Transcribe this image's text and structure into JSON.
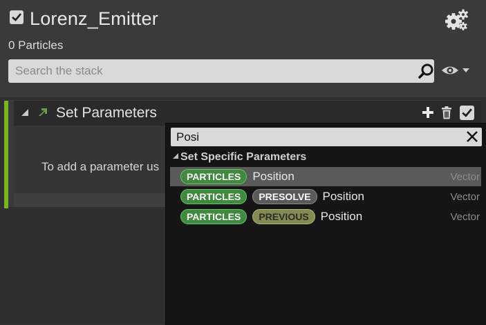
{
  "header": {
    "title": "Lorenz_Emitter",
    "particle_count": "0 Particles"
  },
  "search": {
    "placeholder": "Search the stack",
    "value": ""
  },
  "module": {
    "title": "Set Parameters",
    "hint": "To add a parameter us"
  },
  "popup": {
    "query": "Posi",
    "category": "Set Specific Parameters",
    "rows": [
      {
        "pills": [
          {
            "label": "PARTICLES",
            "style": "particles"
          }
        ],
        "name": "Position",
        "type": "Vector",
        "selected": true
      },
      {
        "pills": [
          {
            "label": "PARTICLES",
            "style": "particles"
          },
          {
            "label": "PRESOLVE",
            "style": "presolve"
          }
        ],
        "name": "Position",
        "type": "Vector",
        "selected": false
      },
      {
        "pills": [
          {
            "label": "PARTICLES",
            "style": "particles"
          },
          {
            "label": "PREVIOUS",
            "style": "previous"
          }
        ],
        "name": "Position",
        "type": "Vector",
        "selected": false
      }
    ]
  },
  "icons": {
    "enabled_checkbox": "check-icon",
    "settings": "gear-icon",
    "search": "search-icon",
    "visibility": "eye-icon",
    "add": "plus-icon",
    "delete": "trash-icon",
    "close": "close-icon"
  },
  "colors": {
    "accent_green": "#7ab51d",
    "particles_pill": "#3f8a3f",
    "presolve_pill": "#5a5a5a",
    "previous_pill": "#838a52"
  }
}
